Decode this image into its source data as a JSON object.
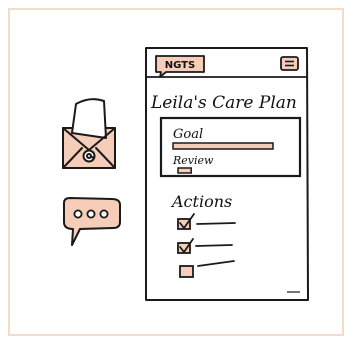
{
  "colors": {
    "border": "#f5dcc8",
    "ink": "#1a1a1a",
    "peach": "#f6cdb8",
    "peach_light": "#f8d6c4",
    "paper": "#ffffff"
  },
  "phone": {
    "logo": "NGTS",
    "menu_icon": "hamburger-menu-icon",
    "title": "Leila's Care Plan",
    "card": {
      "goal_label": "Goal",
      "goal_progress": 1.0,
      "review_label": "Review",
      "review_progress": 0.22
    },
    "actions": {
      "heading": "Actions",
      "items": [
        {
          "checked": true
        },
        {
          "checked": true
        },
        {
          "checked": false
        }
      ]
    }
  },
  "side_icons": {
    "email": "envelope-at-icon",
    "chat": "chat-bubble-dots-icon",
    "chat_dots": "ooo"
  }
}
